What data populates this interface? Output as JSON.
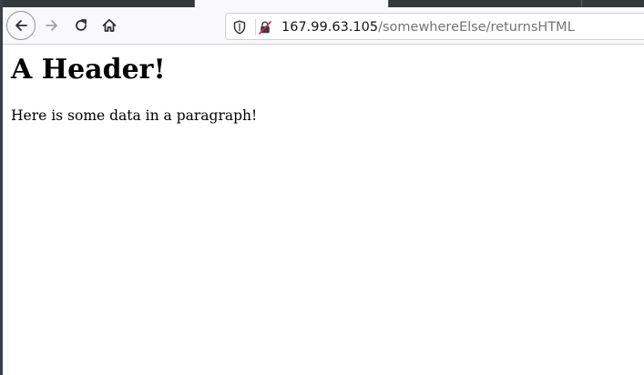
{
  "browser": {
    "url": {
      "host": "167.99.63.105",
      "path": "/somewhereElse/returnsHTML"
    },
    "icons": {
      "back": "arrow-left-icon",
      "forward": "arrow-right-icon",
      "reload": "reload-icon",
      "home": "home-icon",
      "tracking": "shield-icon",
      "security": "insecure-lock-icon"
    }
  },
  "page": {
    "heading": "A Header!",
    "paragraph": "Here is some data in a paragraph!"
  }
}
